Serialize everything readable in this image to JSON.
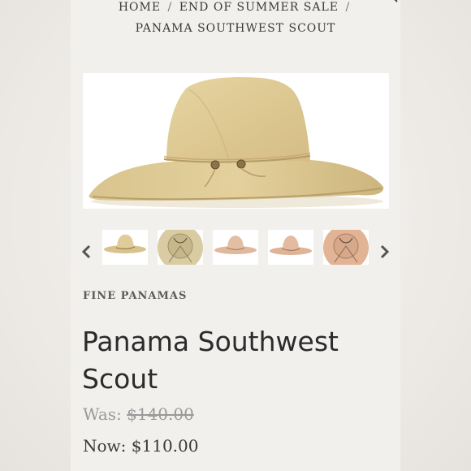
{
  "breadcrumb": {
    "items": [
      "HOME",
      "END OF SUMMER SALE",
      "PANAMA SOUTHWEST SCOUT"
    ],
    "separator": "/"
  },
  "gallery": {
    "main_image": "straw-hat-photo",
    "thumbnails": [
      "straw-hat-side",
      "hat-interior-tan",
      "hat-pinkish-side",
      "hat-pinkish-side-2",
      "hat-interior-pink"
    ],
    "prev_icon": "chevron-left-icon",
    "next_icon": "chevron-right-icon"
  },
  "product": {
    "vendor": "FINE PANAMAS",
    "title_line1": "Panama Southwest",
    "title_line2": "Scout",
    "was_label": "Was:",
    "was_price": "$140.00",
    "now_label": "Now:",
    "now_price": "$110.00"
  },
  "colors": {
    "text_dark": "#2b2b2b",
    "muted": "#9a9a9a",
    "background": "#f2f0ed"
  }
}
